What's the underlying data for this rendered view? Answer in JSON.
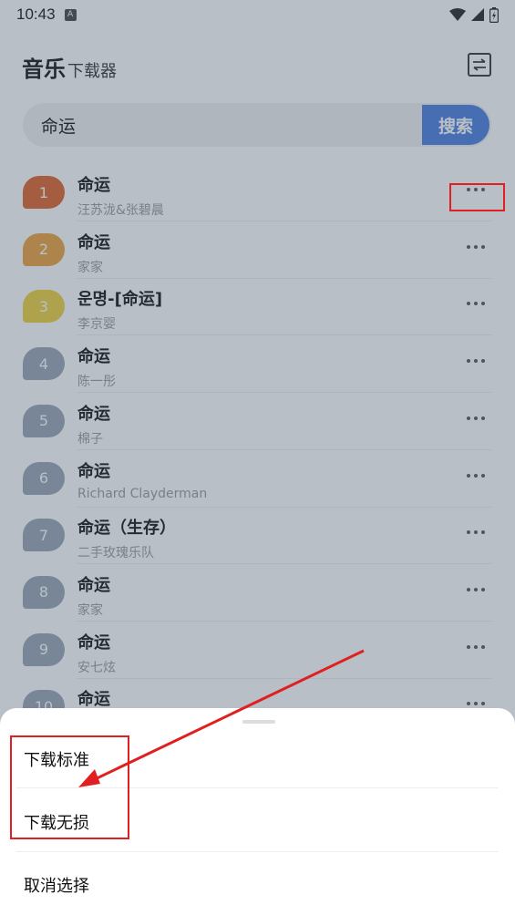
{
  "status_bar": {
    "time": "10:43",
    "notif_icon": "A"
  },
  "header": {
    "title_main": "音乐",
    "title_sub": "下载器"
  },
  "search": {
    "value": "命运",
    "button_label": "搜索"
  },
  "songs": [
    {
      "rank": "1",
      "title": "命运",
      "artist": "汪苏泷&张碧晨",
      "color": "#e0622a"
    },
    {
      "rank": "2",
      "title": "命运",
      "artist": "家家",
      "color": "#eda23a"
    },
    {
      "rank": "3",
      "title": "운명-[命运]",
      "artist": "李京婴",
      "color": "#f0d03a"
    },
    {
      "rank": "4",
      "title": "命运",
      "artist": "陈一彤",
      "color": "#9aa4b3"
    },
    {
      "rank": "5",
      "title": "命运",
      "artist": "棉子",
      "color": "#9aa4b3"
    },
    {
      "rank": "6",
      "title": "命运",
      "artist": "Richard Clayderman",
      "color": "#9aa4b3"
    },
    {
      "rank": "7",
      "title": "命运（生存）",
      "artist": "二手玫瑰乐队",
      "color": "#9aa4b3"
    },
    {
      "rank": "8",
      "title": "命运",
      "artist": "家家",
      "color": "#9aa4b3"
    },
    {
      "rank": "9",
      "title": "命运",
      "artist": "安七炫",
      "color": "#9aa4b3"
    },
    {
      "rank": "10",
      "title": "命运",
      "artist": "",
      "color": "#9aa4b3"
    }
  ],
  "sheet": {
    "options": [
      "下载标准",
      "下载无损"
    ],
    "cancel": "取消选择"
  },
  "colors": {
    "accent": "#4a7ce0",
    "annotation": "#e02020"
  }
}
